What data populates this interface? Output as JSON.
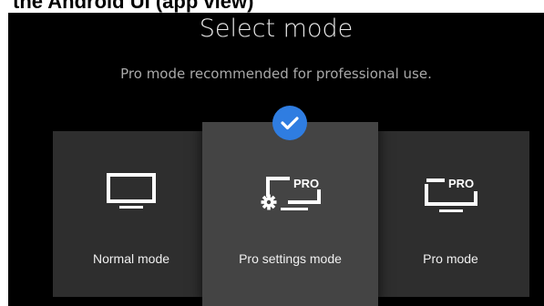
{
  "caption": "the Android UI (app view)",
  "screen": {
    "title": "Select mode",
    "subtitle": "Pro mode recommended for professional use."
  },
  "modes": [
    {
      "label": "Normal mode",
      "icon": "tv-icon",
      "selected": false
    },
    {
      "label": "Pro settings mode",
      "icon": "tv-pro-settings-icon",
      "badge": "PRO",
      "selected": true
    },
    {
      "label": "Pro mode",
      "icon": "tv-pro-icon",
      "badge": "PRO",
      "selected": false
    }
  ],
  "colors": {
    "background": "#000000",
    "card": "#2e2e2e",
    "card_selected": "#444444",
    "accent": "#2f7de1",
    "text": "#f0f0f0"
  }
}
